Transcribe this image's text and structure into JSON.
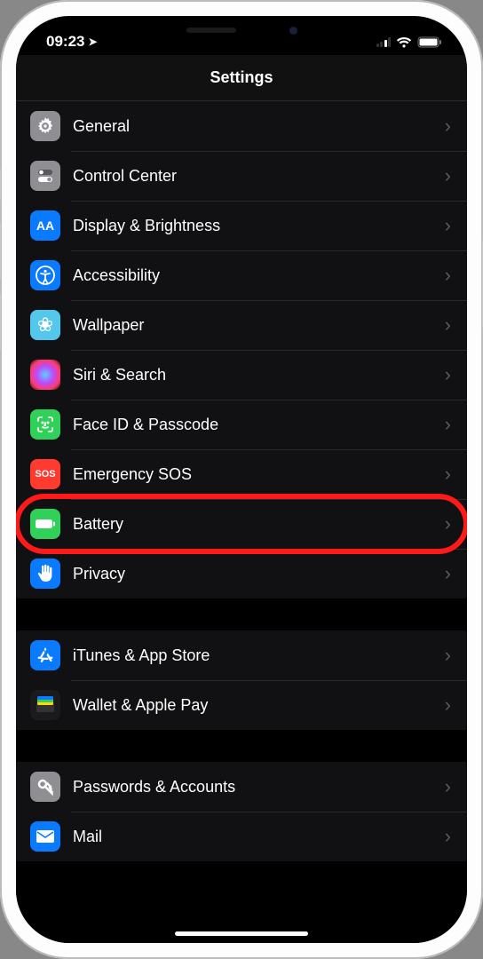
{
  "status": {
    "time": "09:23"
  },
  "nav": {
    "title": "Settings"
  },
  "groups": [
    {
      "rows": [
        {
          "id": "general",
          "label": "General",
          "icon": "gear-icon",
          "bg": "#8e8e93"
        },
        {
          "id": "control",
          "label": "Control Center",
          "icon": "switches-icon",
          "bg": "#8e8e93"
        },
        {
          "id": "display",
          "label": "Display & Brightness",
          "icon": "text-size-icon",
          "bg": "#0a7aff"
        },
        {
          "id": "accessibility",
          "label": "Accessibility",
          "icon": "accessibility-icon",
          "bg": "#0a7aff"
        },
        {
          "id": "wallpaper",
          "label": "Wallpaper",
          "icon": "flower-icon",
          "bg": "#54c7ec"
        },
        {
          "id": "siri",
          "label": "Siri & Search",
          "icon": "siri-icon",
          "bg": "#1b1b1e"
        },
        {
          "id": "faceid",
          "label": "Face ID & Passcode",
          "icon": "faceid-icon",
          "bg": "#30d158"
        },
        {
          "id": "sos",
          "label": "Emergency SOS",
          "icon": "sos-icon",
          "bg": "#ff3b30"
        },
        {
          "id": "battery",
          "label": "Battery",
          "icon": "battery-icon",
          "bg": "#30d158",
          "highlighted": true
        },
        {
          "id": "privacy",
          "label": "Privacy",
          "icon": "hand-icon",
          "bg": "#0a7aff"
        }
      ]
    },
    {
      "rows": [
        {
          "id": "itunes",
          "label": "iTunes & App Store",
          "icon": "appstore-icon",
          "bg": "#0a7aff"
        },
        {
          "id": "wallet",
          "label": "Wallet & Apple Pay",
          "icon": "wallet-icon",
          "bg": "#1b1b1e"
        }
      ]
    },
    {
      "rows": [
        {
          "id": "passwords",
          "label": "Passwords & Accounts",
          "icon": "key-icon",
          "bg": "#8e8e93"
        },
        {
          "id": "mail",
          "label": "Mail",
          "icon": "mail-icon",
          "bg": "#0a7aff"
        }
      ]
    }
  ],
  "icons": {
    "gear-icon": "⚙︎",
    "switches-icon": "⌥",
    "text-size-icon": "AA",
    "accessibility-icon": "⊚",
    "flower-icon": "❀",
    "siri-icon": "◉",
    "faceid-icon": "☺",
    "sos-icon": "SOS",
    "battery-icon": "▮",
    "hand-icon": "✋",
    "appstore-icon": "Ⓐ",
    "wallet-icon": "▦",
    "key-icon": "🔑",
    "mail-icon": "✉"
  }
}
